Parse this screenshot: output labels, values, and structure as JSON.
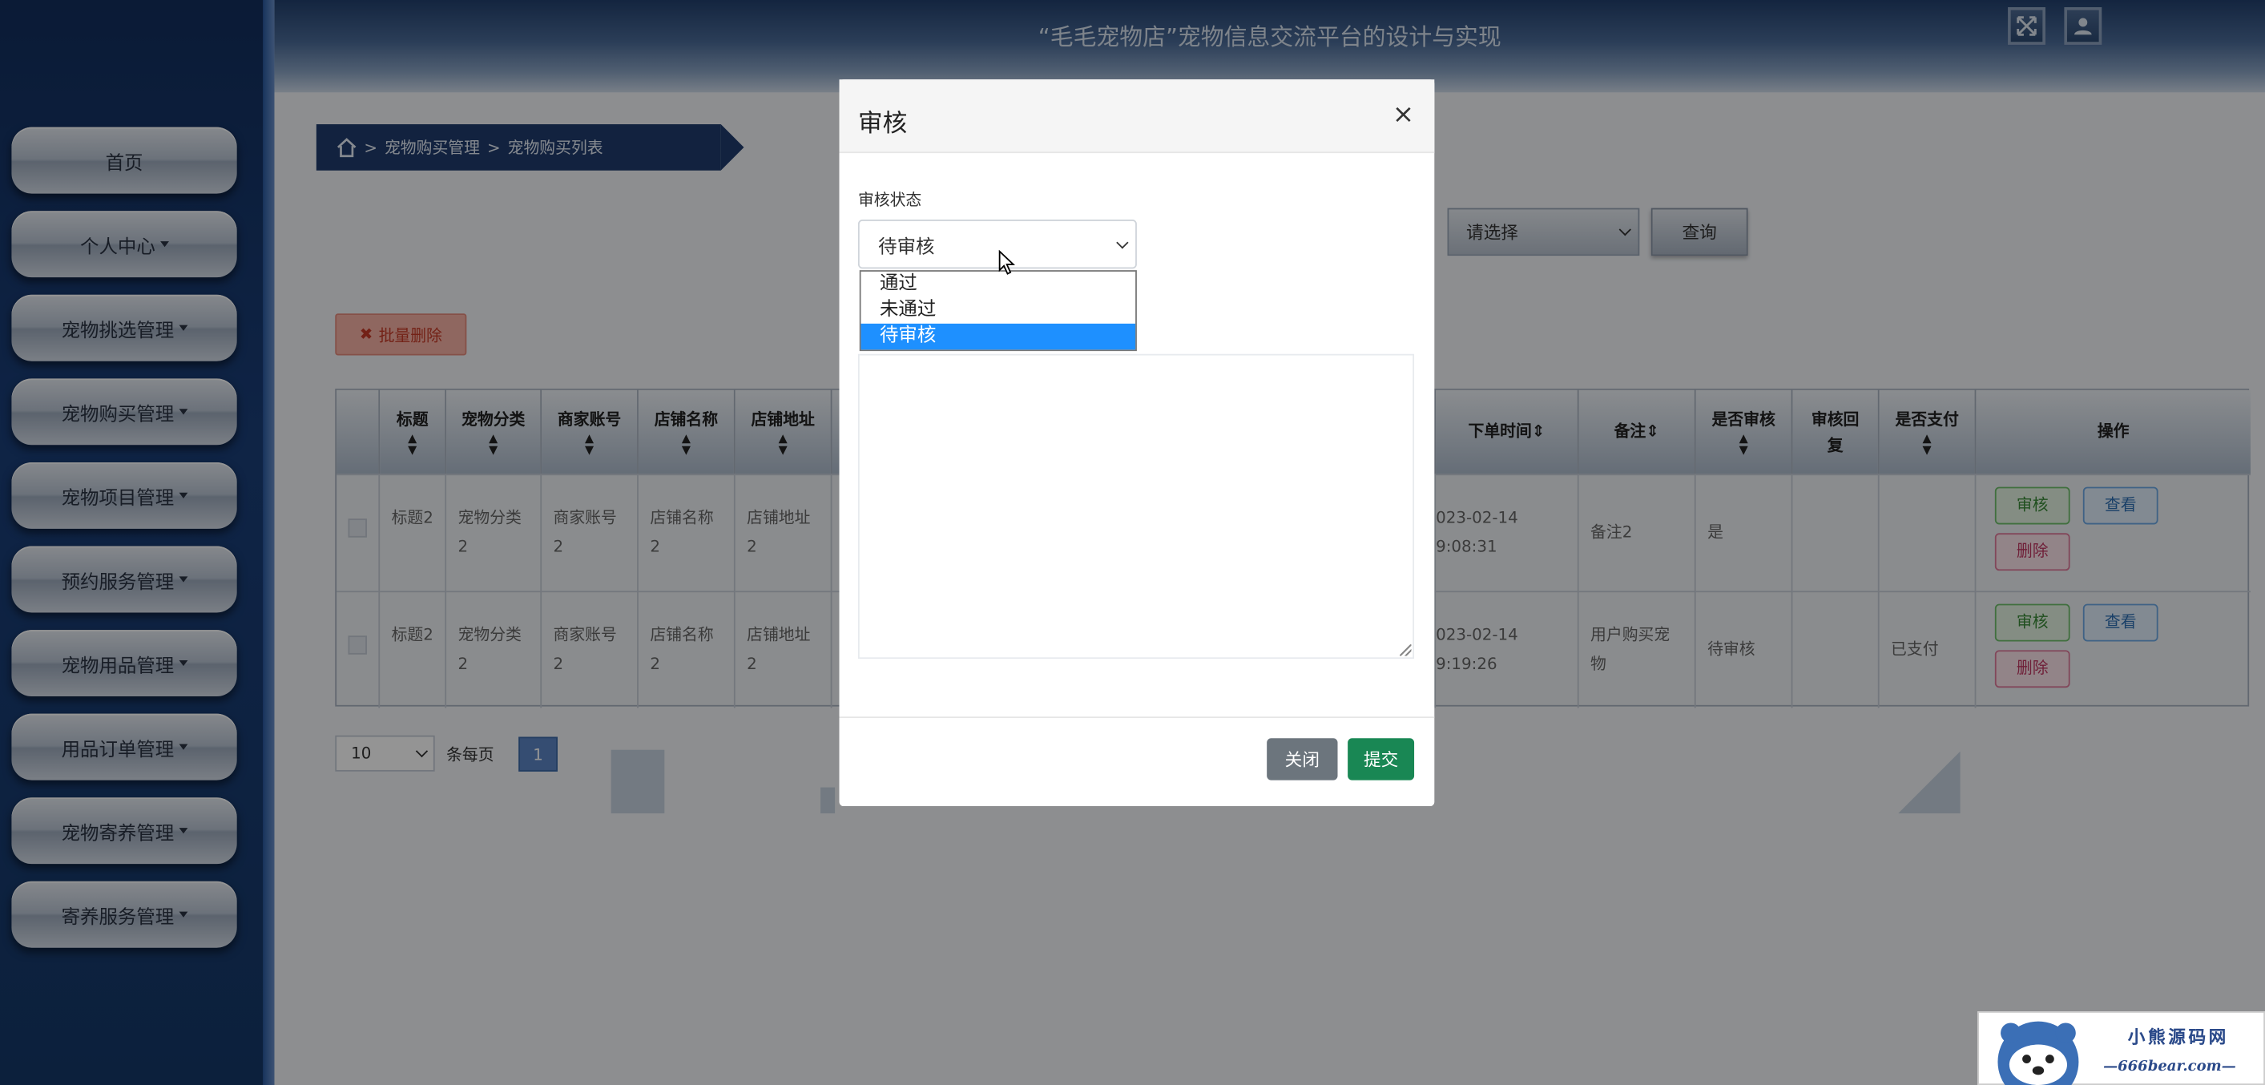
{
  "app": {
    "title": "“毛毛宠物店”宠物信息交流平台的设计与实现"
  },
  "sidebar": {
    "items": [
      {
        "label": "首页",
        "dropdown": false
      },
      {
        "label": "个人中心",
        "dropdown": true
      },
      {
        "label": "宠物挑选管理",
        "dropdown": true
      },
      {
        "label": "宠物购买管理",
        "dropdown": true
      },
      {
        "label": "宠物项目管理",
        "dropdown": true
      },
      {
        "label": "预约服务管理",
        "dropdown": true
      },
      {
        "label": "宠物用品管理",
        "dropdown": true
      },
      {
        "label": "用品订单管理",
        "dropdown": true
      },
      {
        "label": "宠物寄养管理",
        "dropdown": true
      },
      {
        "label": "寄养服务管理",
        "dropdown": true
      }
    ]
  },
  "breadcrumb": {
    "sep": ">",
    "level1": "宠物购买管理",
    "level2": "宠物购买列表"
  },
  "search": {
    "select_value": "请选择",
    "query_label": "查询"
  },
  "toolbar": {
    "batch_delete_label": "批量删除"
  },
  "table": {
    "headers": [
      "标题",
      "宠物分类",
      "商家账号",
      "店铺名称",
      "店铺地址",
      "下单时间",
      "备注",
      "是否审核",
      "审核回复",
      "是否支付",
      "操作"
    ],
    "rows": [
      {
        "title": "标题2",
        "category": "宠物分类2",
        "account": "商家账号2",
        "shop": "店铺名称2",
        "address": "店铺地址2",
        "time_a": "023-02-14",
        "time_b": "9:08:31",
        "remark": "备注2",
        "audited": "是",
        "reply": "",
        "paid": ""
      },
      {
        "title": "标题2",
        "category": "宠物分类2",
        "account": "商家账号2",
        "shop": "店铺名称2",
        "address": "店铺地址2",
        "time_a": "023-02-14",
        "time_b": "9:19:26",
        "remark": "用户购买宠物",
        "audited": "待审核",
        "reply": "",
        "paid": "已支付"
      }
    ],
    "actions": {
      "audit": "审核",
      "view": "查看",
      "delete": "删除"
    }
  },
  "pagination": {
    "page_size": "10",
    "per_page_label": "条每页",
    "current_page": "1"
  },
  "modal": {
    "title": "审核",
    "close_symbol": "×",
    "status_label": "审核状态",
    "status_value": "待审核",
    "options": [
      "通过",
      "未通过",
      "待审核"
    ],
    "selected_option": "待审核",
    "close_label": "关闭",
    "submit_label": "提交"
  },
  "watermark": {
    "line1": "小熊源码网",
    "line2": "—666bear.com—"
  },
  "colors": {
    "sidebar": "#1a3e78",
    "accent": "#1e90ff",
    "submit": "#198754",
    "close": "#6c757d"
  }
}
